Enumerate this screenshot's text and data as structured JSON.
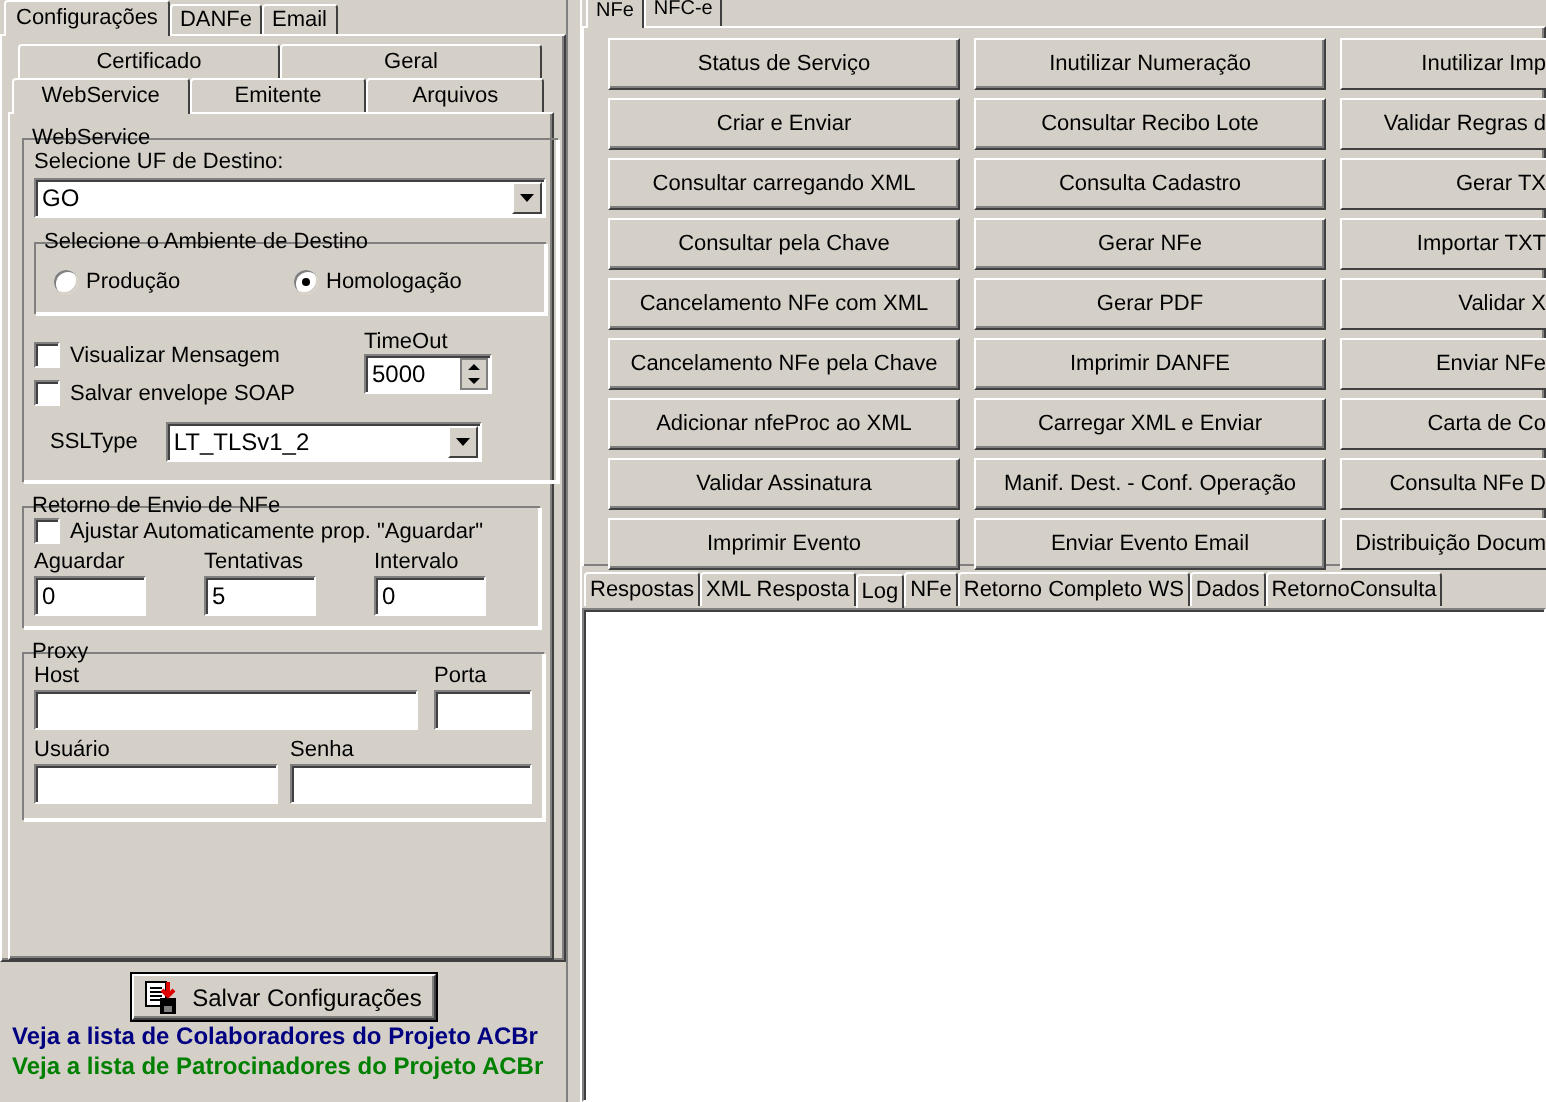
{
  "config_tabs": [
    {
      "label": "Configurações",
      "selected": true
    },
    {
      "label": "DANFe",
      "selected": false
    },
    {
      "label": "Email",
      "selected": false
    }
  ],
  "sub_tabs_back": [
    {
      "label": "Certificado",
      "selected": false
    },
    {
      "label": "Geral",
      "selected": false
    }
  ],
  "sub_tabs_front": [
    {
      "label": "WebService",
      "selected": true
    },
    {
      "label": "Emitente",
      "selected": false
    },
    {
      "label": "Arquivos",
      "selected": false
    }
  ],
  "webservice": {
    "title": "WebService",
    "uf_label": "Selecione UF de Destino:",
    "uf_value": "GO",
    "ambiente": {
      "title": "Selecione o Ambiente de Destino",
      "options": [
        {
          "label": "Produção",
          "selected": false
        },
        {
          "label": "Homologação",
          "selected": true
        }
      ]
    },
    "checkboxes": [
      {
        "label": "Visualizar Mensagem",
        "checked": false
      },
      {
        "label": "Salvar envelope SOAP",
        "checked": false
      }
    ],
    "timeout": {
      "label": "TimeOut",
      "value": "5000"
    },
    "ssl": {
      "label": "SSLType",
      "value": "LT_TLSv1_2"
    }
  },
  "retorno": {
    "title": "Retorno de Envio de NFe",
    "checkbox": {
      "label": "Ajustar Automaticamente prop. \"Aguardar\"",
      "checked": false
    },
    "fields": [
      {
        "label": "Aguardar",
        "value": "0"
      },
      {
        "label": "Tentativas",
        "value": "5"
      },
      {
        "label": "Intervalo",
        "value": "0"
      }
    ]
  },
  "proxy": {
    "title": "Proxy",
    "fields": [
      {
        "label": "Host"
      },
      {
        "label": "Porta"
      },
      {
        "label": "Usuário"
      },
      {
        "label": "Senha"
      }
    ]
  },
  "save_button": "Salvar Configurações",
  "links": [
    {
      "text": "Veja a lista de Colaboradores do Projeto ACBr",
      "color": "#000080"
    },
    {
      "text": "Veja a lista de Patrocinadores do Projeto ACBr",
      "color": "#008000"
    }
  ],
  "main_tabs": [
    {
      "label": "NFe",
      "selected": true
    },
    {
      "label": "NFC-e",
      "selected": false
    }
  ],
  "actions": [
    [
      "Status de Serviço",
      "Inutilizar Numeração",
      "Inutilizar Imp"
    ],
    [
      "Criar e Enviar",
      "Consultar Recibo Lote",
      "Validar Regras d"
    ],
    [
      "Consultar carregando XML",
      "Consulta Cadastro",
      "Gerar TX"
    ],
    [
      "Consultar pela Chave",
      "Gerar NFe",
      "Importar TXT"
    ],
    [
      "Cancelamento NFe com XML",
      "Gerar PDF",
      "Validar X"
    ],
    [
      "Cancelamento NFe pela Chave",
      "Imprimir DANFE",
      "Enviar NFe"
    ],
    [
      "Adicionar nfeProc ao XML",
      "Carregar XML e Enviar",
      "Carta de Co"
    ],
    [
      "Validar Assinatura",
      "Manif. Dest. - Conf. Operação",
      "Consulta NFe D"
    ],
    [
      "Imprimir Evento",
      "Enviar Evento Email",
      "Distribuição Docum"
    ]
  ],
  "output_tabs": [
    {
      "label": "Respostas",
      "selected": false
    },
    {
      "label": "XML Resposta",
      "selected": false
    },
    {
      "label": "Log",
      "selected": true
    },
    {
      "label": "NFe",
      "selected": false
    },
    {
      "label": "Retorno Completo WS",
      "selected": false
    },
    {
      "label": "Dados",
      "selected": false
    },
    {
      "label": "RetornoConsulta",
      "selected": false
    }
  ]
}
